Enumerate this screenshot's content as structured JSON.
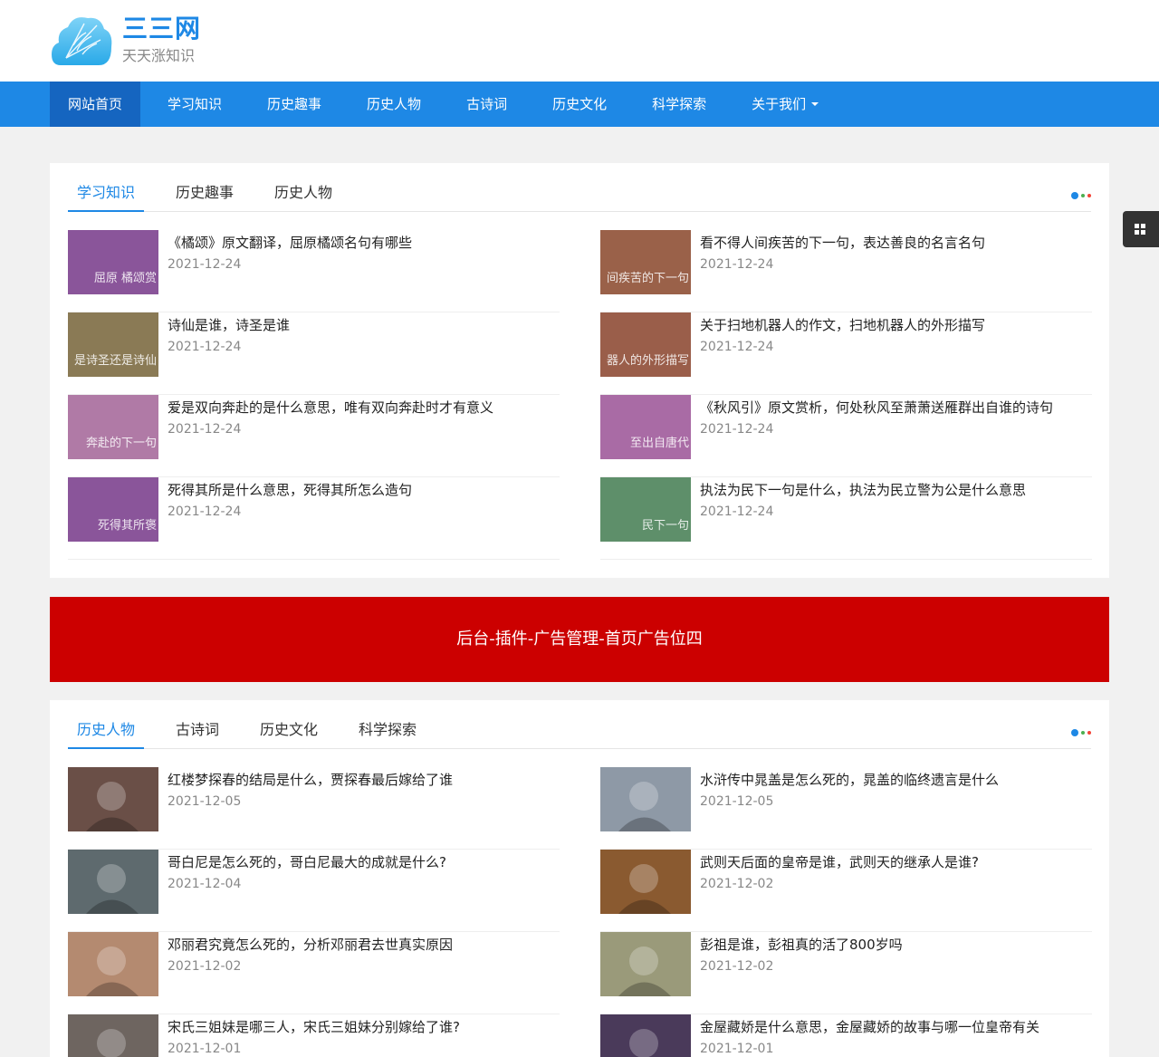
{
  "site": {
    "name": "三三网",
    "slogan": "天天涨知识"
  },
  "nav": {
    "items": [
      "网站首页",
      "学习知识",
      "历史趣事",
      "历史人物",
      "古诗词",
      "历史文化",
      "科学探索",
      "关于我们"
    ],
    "active_index": 0
  },
  "section1": {
    "tabs": [
      "学习知识",
      "历史趣事",
      "历史人物"
    ],
    "active_tab": 0,
    "articles": [
      {
        "title": "《橘颂》原文翻译，屈原橘颂名句有哪些",
        "date": "2021-12-24",
        "thumb_text": "屈原 橘颂赏",
        "thumb_color": "#8a559a"
      },
      {
        "title": "看不得人间疾苦的下一句，表达善良的名言名句",
        "date": "2021-12-24",
        "thumb_text": "间疾苦的下一句",
        "thumb_color": "#9a6149"
      },
      {
        "title": "诗仙是谁，诗圣是谁",
        "date": "2021-12-24",
        "thumb_text": "是诗圣还是诗仙",
        "thumb_color": "#8a7a55"
      },
      {
        "title": "关于扫地机器人的作文，扫地机器人的外形描写",
        "date": "2021-12-24",
        "thumb_text": "器人的外形描写",
        "thumb_color": "#9a5e4a"
      },
      {
        "title": "爱是双向奔赴的是什么意思，唯有双向奔赴时才有意义",
        "date": "2021-12-24",
        "thumb_text": "奔赴的下一句",
        "thumb_color": "#b07aa6"
      },
      {
        "title": "《秋风引》原文赏析，何处秋风至萧萧送雁群出自谁的诗句",
        "date": "2021-12-24",
        "thumb_text": "至出自唐代",
        "thumb_color": "#a96ba5"
      },
      {
        "title": "死得其所是什么意思，死得其所怎么造句",
        "date": "2021-12-24",
        "thumb_text": "死得其所褒",
        "thumb_color": "#8a559a"
      },
      {
        "title": "执法为民下一句是什么，执法为民立警为公是什么意思",
        "date": "2021-12-24",
        "thumb_text": "民下一句",
        "thumb_color": "#5e8f6a"
      }
    ]
  },
  "ad": {
    "text": "后台-插件-广告管理-首页广告位四"
  },
  "section2": {
    "tabs": [
      "历史人物",
      "古诗词",
      "历史文化",
      "科学探索"
    ],
    "active_tab": 0,
    "articles": [
      {
        "title": "红楼梦探春的结局是什么，贾探春最后嫁给了谁",
        "date": "2021-12-05",
        "thumb_color": "#6a4f47"
      },
      {
        "title": "水浒传中晁盖是怎么死的，晁盖的临终遗言是什么",
        "date": "2021-12-05",
        "thumb_color": "#8e99a6"
      },
      {
        "title": "哥白尼是怎么死的，哥白尼最大的成就是什么?",
        "date": "2021-12-04",
        "thumb_color": "#5e6a6e"
      },
      {
        "title": "武则天后面的皇帝是谁，武则天的继承人是谁?",
        "date": "2021-12-02",
        "thumb_color": "#8a5a30"
      },
      {
        "title": "邓丽君究竟怎么死的，分析邓丽君去世真实原因",
        "date": "2021-12-02",
        "thumb_color": "#b48a70"
      },
      {
        "title": "彭祖是谁，彭祖真的活了800岁吗",
        "date": "2021-12-02",
        "thumb_color": "#9a9a7a"
      },
      {
        "title": "宋氏三姐妹是哪三人，宋氏三姐妹分别嫁给了谁?",
        "date": "2021-12-01",
        "thumb_color": "#6e6560"
      },
      {
        "title": "金屋藏娇是什么意思，金屋藏娇的故事与哪一位皇帝有关",
        "date": "2021-12-01",
        "thumb_color": "#4a3a5a"
      }
    ]
  },
  "colors": {
    "brand": "#1e88e5",
    "nav_active": "#1565c0",
    "ad_bg": "#cc0000"
  }
}
